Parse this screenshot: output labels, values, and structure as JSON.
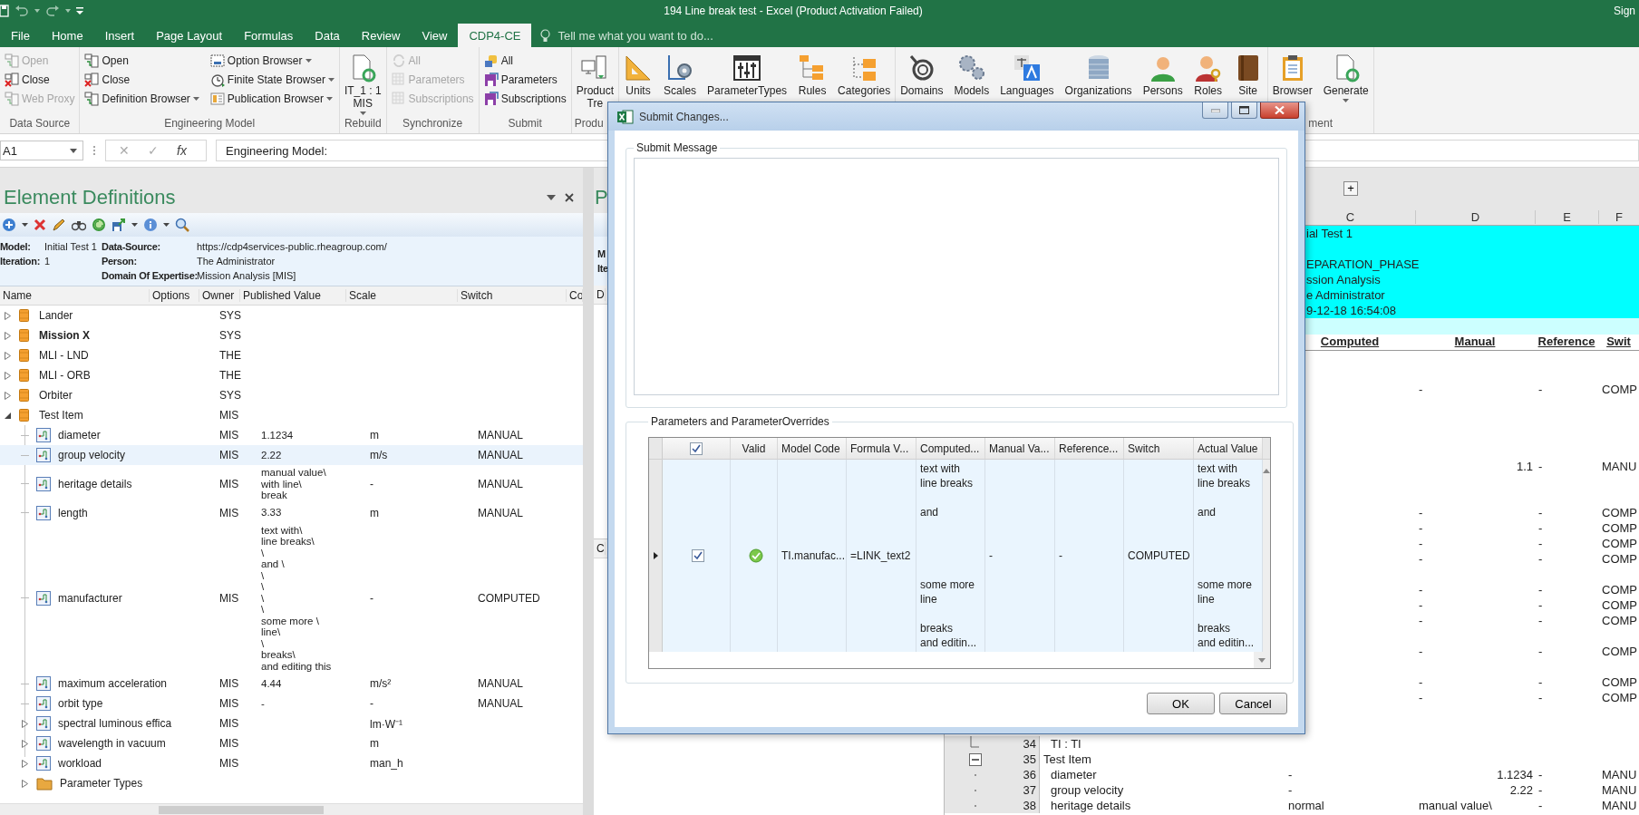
{
  "window": {
    "title": "194 Line break test - Excel (Product Activation Failed)",
    "account": "Sign"
  },
  "tabs": [
    {
      "label": "File",
      "selected": false
    },
    {
      "label": "Home",
      "selected": false
    },
    {
      "label": "Insert",
      "selected": false
    },
    {
      "label": "Page Layout",
      "selected": false
    },
    {
      "label": "Formulas",
      "selected": false
    },
    {
      "label": "Data",
      "selected": false
    },
    {
      "label": "Review",
      "selected": false
    },
    {
      "label": "View",
      "selected": false
    },
    {
      "label": "CDP4-CE",
      "selected": true
    }
  ],
  "tell_me": {
    "placeholder": "Tell me what you want to do..."
  },
  "ribbon_groups": [
    {
      "label": "Data Source",
      "kind": "small",
      "columns": [
        [
          {
            "label": "Open",
            "disabled": true,
            "dropdown": false
          },
          {
            "label": "Close",
            "disabled": false,
            "dropdown": false
          },
          {
            "label": "Web Proxy",
            "disabled": true,
            "dropdown": false
          }
        ]
      ]
    },
    {
      "label": "Engineering Model",
      "kind": "small",
      "columns": [
        [
          {
            "label": "Open",
            "disabled": false,
            "dropdown": false
          },
          {
            "label": "Close",
            "disabled": false,
            "dropdown": false
          },
          {
            "label": "Definition Browser",
            "disabled": false,
            "dropdown": true
          }
        ],
        [
          {
            "label": "Option Browser",
            "disabled": false,
            "dropdown": true
          },
          {
            "label": "Finite State Browser",
            "disabled": false,
            "dropdown": true
          },
          {
            "label": "Publication Browser",
            "disabled": false,
            "dropdown": true
          }
        ]
      ]
    },
    {
      "label": "Rebuild",
      "kind": "large",
      "buttons": [
        {
          "lines": [
            "IT_1 : 1",
            "MIS"
          ],
          "dropdown": true
        }
      ]
    },
    {
      "label": "Synchronize",
      "kind": "small",
      "columns": [
        [
          {
            "label": "All",
            "disabled": true,
            "dropdown": false
          },
          {
            "label": "Parameters",
            "disabled": true,
            "dropdown": false
          },
          {
            "label": "Subscriptions",
            "disabled": true,
            "dropdown": false
          }
        ]
      ]
    },
    {
      "label": "Submit",
      "kind": "small",
      "columns": [
        [
          {
            "label": "All",
            "disabled": false,
            "dropdown": false
          },
          {
            "label": "Parameters",
            "disabled": false,
            "dropdown": false
          },
          {
            "label": "Subscriptions",
            "disabled": false,
            "dropdown": false
          }
        ]
      ]
    },
    {
      "label": "Produ",
      "kind": "large",
      "buttons": [
        {
          "lines": [
            "Product",
            "Tre"
          ],
          "dropdown": false
        }
      ]
    },
    {
      "kind": "large",
      "buttons": [
        {
          "lines": [
            "Units"
          ],
          "dropdown": false
        },
        {
          "lines": [
            "Scales"
          ],
          "dropdown": false
        },
        {
          "lines": [
            "ParameterTypes"
          ],
          "dropdown": false
        },
        {
          "lines": [
            "Rules"
          ],
          "dropdown": false
        },
        {
          "lines": [
            "Categories"
          ],
          "dropdown": false
        }
      ]
    },
    {
      "kind": "large",
      "buttons": [
        {
          "lines": [
            "Domains"
          ],
          "dropdown": false
        },
        {
          "lines": [
            "Models"
          ],
          "dropdown": false
        },
        {
          "lines": [
            "Languages"
          ],
          "dropdown": false
        },
        {
          "lines": [
            "Organizations"
          ],
          "dropdown": false
        },
        {
          "lines": [
            "Persons"
          ],
          "dropdown": false
        },
        {
          "lines": [
            "Roles"
          ],
          "dropdown": false
        },
        {
          "lines": [
            "Site"
          ],
          "dropdown": false
        }
      ]
    },
    {
      "label": "ment",
      "kind": "large",
      "buttons": [
        {
          "lines": [
            "Browser"
          ],
          "dropdown": false
        },
        {
          "lines": [
            "Generate"
          ],
          "dropdown": true
        }
      ]
    }
  ],
  "formula_bar": {
    "name_box": "A1",
    "buttons": [
      "✕",
      "✓",
      "fx"
    ],
    "formula": "Engineering Model:"
  },
  "element_definitions": {
    "title": "Element Definitions",
    "info_rows": [
      {
        "left": {
          "label": "Model:",
          "value": "Initial Test 1"
        },
        "right": {
          "label": "Data-Source:",
          "value": "https://cdp4services-public.rheagroup.com/"
        }
      },
      {
        "left": {
          "label": "Iteration:",
          "value": "1"
        },
        "right": {
          "label": "Person:",
          "value": "The Administrator"
        }
      },
      {
        "right": {
          "label": "Domain Of Expertise:",
          "value": "Mission Analysis [MIS]"
        }
      }
    ],
    "columns": [
      "Name",
      "Options",
      "Owner",
      "Published Value",
      "Scale",
      "Switch",
      "Co"
    ],
    "tree": [
      {
        "name": "Lander",
        "owner": "SYS",
        "bold": false,
        "expanded": false,
        "selected": false
      },
      {
        "name": "Mission X",
        "owner": "SYS",
        "bold": true,
        "expanded": false,
        "selected": false
      },
      {
        "name": "MLI - LND",
        "owner": "THE",
        "bold": false,
        "expanded": false,
        "selected": false
      },
      {
        "name": "MLI - ORB",
        "owner": "THE",
        "bold": false,
        "expanded": false,
        "selected": false
      },
      {
        "name": "Orbiter",
        "owner": "SYS",
        "bold": false,
        "expanded": false,
        "selected": false
      },
      {
        "name": "Test Item",
        "owner": "MIS",
        "bold": false,
        "expanded": true,
        "selected": false,
        "children": [
          {
            "kind": "parameter",
            "name": "diameter",
            "owner": "MIS",
            "value": "1.1234",
            "scale": "m",
            "switch": "MANUAL",
            "expandable": false,
            "selected": false
          },
          {
            "kind": "parameter",
            "name": "group velocity",
            "owner": "MIS",
            "value": "2.22",
            "scale": "m/s",
            "switch": "MANUAL",
            "expandable": false,
            "selected": true
          },
          {
            "kind": "parameter",
            "name": "heritage details",
            "owner": "MIS",
            "value": "manual value\\\nwith line\\\nbreak",
            "scale": "-",
            "switch": "MANUAL",
            "expandable": false,
            "selected": false
          },
          {
            "kind": "parameter",
            "name": "length",
            "owner": "MIS",
            "value": "3.33",
            "scale": "m",
            "switch": "MANUAL",
            "expandable": false,
            "selected": false
          },
          {
            "kind": "parameter",
            "name": "manufacturer",
            "owner": "MIS",
            "value": "text with\\\nline breaks\\\n\\\nand \\\n\\\n\\\n\\\n\\\nsome more \\\nline\\\n\\\nbreaks\\\nand editing this",
            "scale": "-",
            "switch": "COMPUTED",
            "expandable": false,
            "selected": false
          },
          {
            "kind": "parameter",
            "name": "maximum acceleration",
            "owner": "MIS",
            "value": "4.44",
            "scale": "m/s²",
            "switch": "MANUAL",
            "expandable": false,
            "selected": false
          },
          {
            "kind": "parameter",
            "name": "orbit type",
            "owner": "MIS",
            "value": "-",
            "scale": "-",
            "switch": "MANUAL",
            "expandable": false,
            "selected": false
          },
          {
            "kind": "parameter",
            "name": "spectral luminous effica",
            "owner": "MIS",
            "scale": "lm·W⁻¹",
            "expandable": true,
            "selected": false
          },
          {
            "kind": "parameter",
            "name": "wavelength in vacuum",
            "owner": "MIS",
            "scale": "m",
            "expandable": true,
            "selected": false
          },
          {
            "kind": "parameter",
            "name": "workload",
            "owner": "MIS",
            "scale": "man_h",
            "expandable": true,
            "selected": false
          },
          {
            "kind": "folder",
            "name": "Parameter Types",
            "expandable": true,
            "selected": false
          }
        ]
      }
    ]
  },
  "middle_pane": {
    "title": "P",
    "info_labels": [
      "M",
      "Ite"
    ],
    "column_header": "D",
    "section_header": "C"
  },
  "sheet": {
    "outline_button": "+",
    "column_headers": [
      "C",
      "D",
      "E",
      "F"
    ],
    "info_lines": [
      {
        "kind": "text",
        "text": "ial Test 1"
      },
      {
        "kind": "blank"
      },
      {
        "kind": "text",
        "text": "EPARATION_PHASE"
      },
      {
        "kind": "text",
        "text": "ssion Analysis"
      },
      {
        "kind": "text",
        "text": "e Administrator"
      },
      {
        "kind": "text",
        "text": "9-12-18 16:54:08"
      }
    ],
    "table_headers": [
      "Computed",
      "Manual",
      "Reference",
      "Swit"
    ],
    "rows": [
      {
        "kind": "blank"
      },
      {
        "kind": "blank"
      },
      {
        "kind": "text",
        "manual": "-",
        "reference": "-",
        "switch": "COMP"
      },
      {
        "kind": "blank"
      },
      {
        "kind": "blank"
      },
      {
        "kind": "blank"
      },
      {
        "kind": "blank"
      },
      {
        "kind": "number",
        "manual": "1.1",
        "reference": "-",
        "switch": "MANU"
      },
      {
        "kind": "blank"
      },
      {
        "kind": "blank"
      },
      {
        "kind": "text",
        "manual": "-",
        "reference": "-",
        "switch": "COMP"
      },
      {
        "kind": "text",
        "manual": "-",
        "reference": "-",
        "switch": "COMP"
      },
      {
        "kind": "text",
        "manual": "-",
        "reference": "-",
        "switch": "COMP"
      },
      {
        "kind": "text",
        "manual": "-",
        "reference": "-",
        "switch": "COMP"
      },
      {
        "kind": "blank"
      },
      {
        "kind": "text",
        "manual": "-",
        "reference": "-",
        "switch": "COMP"
      },
      {
        "kind": "text",
        "manual": "-",
        "reference": "-",
        "switch": "COMP"
      },
      {
        "kind": "text",
        "manual": "-",
        "reference": "-",
        "switch": "COMP"
      },
      {
        "kind": "blank"
      },
      {
        "kind": "text",
        "manual": "-",
        "reference": "-",
        "switch": "COMP"
      },
      {
        "kind": "blank"
      },
      {
        "kind": "text",
        "manual": "-",
        "reference": "-",
        "switch": "COMP"
      },
      {
        "kind": "text",
        "manual": "-",
        "reference": "-",
        "switch": "COMP"
      }
    ],
    "outline_rows": [
      {
        "number": "34",
        "name": "TI : TI",
        "kind": "option"
      },
      {
        "number": "35",
        "name": "Test Item",
        "kind": "element",
        "expanded": true
      },
      {
        "number": "36",
        "name": "diameter",
        "kind": "parameter",
        "computed": "-",
        "manual": {
          "kind": "number",
          "text": "1.1234"
        },
        "reference": "-",
        "switch": "MANU"
      },
      {
        "number": "37",
        "name": "group velocity",
        "kind": "parameter",
        "computed": "-",
        "manual": {
          "kind": "number",
          "text": "2.22"
        },
        "reference": "-",
        "switch": "MANU"
      },
      {
        "number": "38",
        "name": "heritage details",
        "kind": "parameter",
        "computed": "normal",
        "manual": {
          "kind": "text",
          "text": "manual value\\"
        },
        "reference": "-",
        "switch": "MANU"
      }
    ]
  },
  "dialog": {
    "title": "Submit Changes...",
    "message_group": "Submit Message",
    "parameters_group": "Parameters and ParameterOverrides",
    "grid": {
      "header_checked": true,
      "columns": [
        "Valid",
        "Model Code",
        "Formula V...",
        "Computed...",
        "Manual Va...",
        "Reference...",
        "Switch",
        "Actual Value"
      ],
      "rows": [
        {
          "selected": true,
          "checked": true,
          "valid": true,
          "model_code": "TI.manufac...",
          "formula": "=LINK_text2",
          "computed": "text with\nline breaks\n\nand\n\n\n\n\nsome more\nline\n\nbreaks\nand editin...",
          "manual": "-",
          "reference": "-",
          "switch": "COMPUTED",
          "actual": "text with\nline breaks\n\nand\n\n\n\n\nsome more\nline\n\nbreaks\nand editin..."
        }
      ]
    },
    "buttons": [
      "OK",
      "Cancel"
    ]
  }
}
